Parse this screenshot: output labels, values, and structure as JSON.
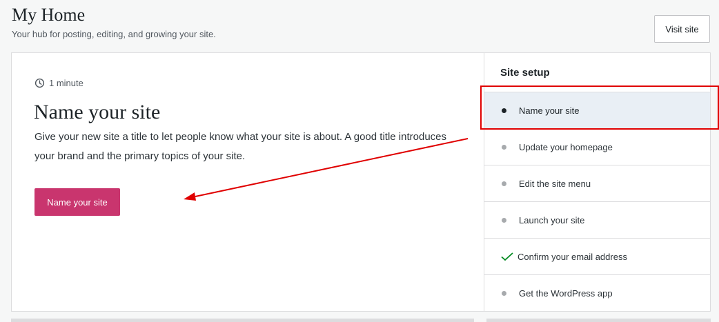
{
  "header": {
    "title": "My Home",
    "subtitle": "Your hub for posting, editing, and growing your site.",
    "visit_site_label": "Visit site"
  },
  "task": {
    "timing": "1 minute",
    "timing_icon": "clock-icon",
    "title": "Name your site",
    "description": "Give your new site a title to let people know what your site is about. A good title introduces your brand and the primary topics of your site.",
    "button_label": "Name your site",
    "button_color": "#c9356e"
  },
  "setup": {
    "heading": "Site setup",
    "items": [
      {
        "label": "Name your site",
        "state": "active"
      },
      {
        "label": "Update your homepage",
        "state": "pending"
      },
      {
        "label": "Edit the site menu",
        "state": "pending"
      },
      {
        "label": "Launch your site",
        "state": "pending"
      },
      {
        "label": "Confirm your email address",
        "state": "completed"
      },
      {
        "label": "Get the WordPress app",
        "state": "pending"
      }
    ]
  },
  "annotation_color": "#e00000"
}
